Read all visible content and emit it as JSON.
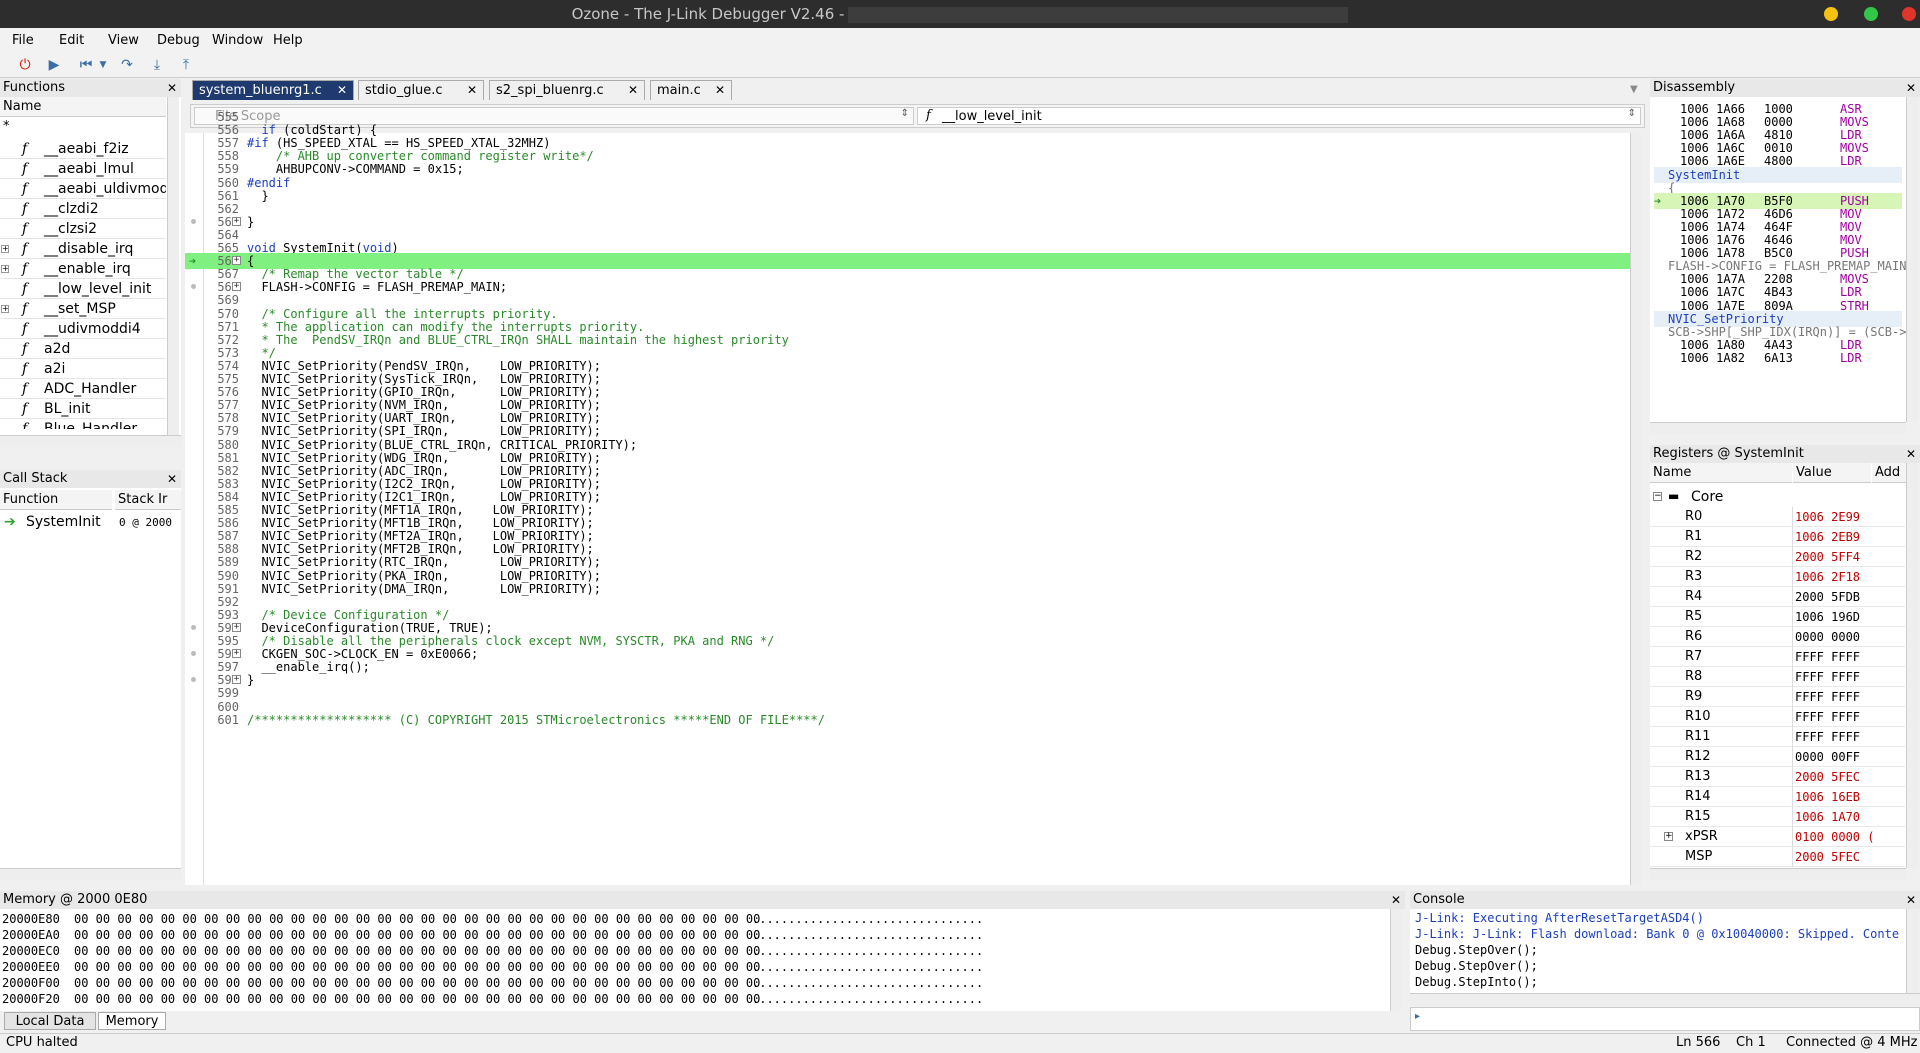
{
  "window": {
    "title": "Ozone - The J-Link Debugger V2.46 -"
  },
  "menu": [
    "File",
    "Edit",
    "View",
    "Debug",
    "Window",
    "Help"
  ],
  "functions": {
    "title": "Functions",
    "column": "Name",
    "filter": "*",
    "items": [
      "__aeabi_f2iz",
      "__aeabi_lmul",
      "__aeabi_uldivmod",
      "__clzdi2",
      "__clzsi2",
      "__disable_irq",
      "__enable_irq",
      "__low_level_init",
      "__set_MSP",
      "__udivmoddi4",
      "a2d",
      "a2i",
      "ADC_Handler",
      "BL_init",
      "Blue_Handler"
    ]
  },
  "callstack": {
    "title": "Call Stack",
    "col_function": "Function",
    "col_stack": "Stack Ir",
    "row_function": "SystemInit",
    "row_stack": "0 @ 2000"
  },
  "tabs": [
    "system_bluenrg1.c",
    "stdio_glue.c",
    "s2_spi_bluenrg.c",
    "main.c"
  ],
  "editor": {
    "scope_placeholder": "File Scope",
    "function_scope": "__low_level_init",
    "function_glyph": "f",
    "lines": [
      {
        "n": "555",
        "t": ""
      },
      {
        "n": "556",
        "t": "  if (coldStart) {"
      },
      {
        "n": "557",
        "t": "#if (HS_SPEED_XTAL == HS_SPEED_XTAL_32MHZ)"
      },
      {
        "n": "558",
        "t": "    /* AHB up converter command register write*/"
      },
      {
        "n": "559",
        "t": "    AHBUPCONV->COMMAND = 0x15;"
      },
      {
        "n": "560",
        "t": "#endif"
      },
      {
        "n": "561",
        "t": "  }"
      },
      {
        "n": "562",
        "t": ""
      },
      {
        "n": "563",
        "t": "}"
      },
      {
        "n": "564",
        "t": ""
      },
      {
        "n": "565",
        "t": "void SystemInit(void)"
      },
      {
        "n": "566",
        "t": "{"
      },
      {
        "n": "567",
        "t": "  /* Remap the vector table */"
      },
      {
        "n": "568",
        "t": "  FLASH->CONFIG = FLASH_PREMAP_MAIN;"
      },
      {
        "n": "569",
        "t": ""
      },
      {
        "n": "570",
        "t": "  /* Configure all the interrupts priority."
      },
      {
        "n": "571",
        "t": "  * The application can modify the interrupts priority."
      },
      {
        "n": "572",
        "t": "  * The  PendSV_IRQn and BLUE_CTRL_IRQn SHALL maintain the highest priority"
      },
      {
        "n": "573",
        "t": "  */"
      },
      {
        "n": "574",
        "t": "  NVIC_SetPriority(PendSV_IRQn,    LOW_PRIORITY);"
      },
      {
        "n": "575",
        "t": "  NVIC_SetPriority(SysTick_IRQn,   LOW_PRIORITY);"
      },
      {
        "n": "576",
        "t": "  NVIC_SetPriority(GPIO_IRQn,      LOW_PRIORITY);"
      },
      {
        "n": "577",
        "t": "  NVIC_SetPriority(NVM_IRQn,       LOW_PRIORITY);"
      },
      {
        "n": "578",
        "t": "  NVIC_SetPriority(UART_IRQn,      LOW_PRIORITY);"
      },
      {
        "n": "579",
        "t": "  NVIC_SetPriority(SPI_IRQn,       LOW_PRIORITY);"
      },
      {
        "n": "580",
        "t": "  NVIC_SetPriority(BLUE_CTRL_IRQn, CRITICAL_PRIORITY);"
      },
      {
        "n": "581",
        "t": "  NVIC_SetPriority(WDG_IRQn,       LOW_PRIORITY);"
      },
      {
        "n": "582",
        "t": "  NVIC_SetPriority(ADC_IRQn,       LOW_PRIORITY);"
      },
      {
        "n": "583",
        "t": "  NVIC_SetPriority(I2C2_IRQn,      LOW_PRIORITY);"
      },
      {
        "n": "584",
        "t": "  NVIC_SetPriority(I2C1_IRQn,      LOW_PRIORITY);"
      },
      {
        "n": "585",
        "t": "  NVIC_SetPriority(MFT1A_IRQn,    LOW_PRIORITY);"
      },
      {
        "n": "586",
        "t": "  NVIC_SetPriority(MFT1B_IRQn,    LOW_PRIORITY);"
      },
      {
        "n": "587",
        "t": "  NVIC_SetPriority(MFT2A_IRQn,    LOW_PRIORITY);"
      },
      {
        "n": "588",
        "t": "  NVIC_SetPriority(MFT2B_IRQn,    LOW_PRIORITY);"
      },
      {
        "n": "589",
        "t": "  NVIC_SetPriority(RTC_IRQn,       LOW_PRIORITY);"
      },
      {
        "n": "590",
        "t": "  NVIC_SetPriority(PKA_IRQn,       LOW_PRIORITY);"
      },
      {
        "n": "591",
        "t": "  NVIC_SetPriority(DMA_IRQn,       LOW_PRIORITY);"
      },
      {
        "n": "592",
        "t": ""
      },
      {
        "n": "593",
        "t": "  /* Device Configuration */"
      },
      {
        "n": "594",
        "t": "  DeviceConfiguration(TRUE, TRUE);"
      },
      {
        "n": "595",
        "t": "  /* Disable all the peripherals clock except NVM, SYSCTR, PKA and RNG */"
      },
      {
        "n": "596",
        "t": "  CKGEN_SOC->CLOCK_EN = 0xE0066;"
      },
      {
        "n": "597",
        "t": "  __enable_irq();"
      },
      {
        "n": "598",
        "t": "}"
      },
      {
        "n": "599",
        "t": ""
      },
      {
        "n": "600",
        "t": ""
      },
      {
        "n": "601",
        "t": "/******************* (C) COPYRIGHT 2015 STMicroelectronics *****END OF FILE****/"
      }
    ]
  },
  "disassembly": {
    "title": "Disassembly",
    "rows": [
      {
        "addr": "1006 1A66",
        "op": "1000",
        "mn": "ASR"
      },
      {
        "addr": "1006 1A68",
        "op": "0000",
        "mn": "MOVS"
      },
      {
        "addr": "1006 1A6A",
        "op": "4810",
        "mn": "LDR"
      },
      {
        "addr": "1006 1A6C",
        "op": "0010",
        "mn": "MOVS"
      },
      {
        "addr": "1006 1A6E",
        "op": "4800",
        "mn": "LDR"
      },
      {
        "label": "SystemInit"
      },
      {
        "src": "{"
      },
      {
        "addr": "1006 1A70",
        "op": "B5F0",
        "mn": "PUSH"
      },
      {
        "addr": "1006 1A72",
        "op": "46D6",
        "mn": "MOV"
      },
      {
        "addr": "1006 1A74",
        "op": "464F",
        "mn": "MOV"
      },
      {
        "addr": "1006 1A76",
        "op": "4646",
        "mn": "MOV"
      },
      {
        "addr": "1006 1A78",
        "op": "B5C0",
        "mn": "PUSH"
      },
      {
        "src": "FLASH->CONFIG = FLASH_PREMAP_MAIN;"
      },
      {
        "addr": "1006 1A7A",
        "op": "2208",
        "mn": "MOVS"
      },
      {
        "addr": "1006 1A7C",
        "op": "4B43",
        "mn": "LDR"
      },
      {
        "addr": "1006 1A7E",
        "op": "809A",
        "mn": "STRH"
      },
      {
        "label": "NVIC_SetPriority"
      },
      {
        "src": "SCB->SHP[_SHP_IDX(IRQn)] = (SCB->S"
      },
      {
        "addr": "1006 1A80",
        "op": "4A43",
        "mn": "LDR"
      },
      {
        "addr": "1006 1A82",
        "op": "6A13",
        "mn": "LDR"
      }
    ]
  },
  "registers": {
    "title": "Registers @ SystemInit",
    "col_name": "Name",
    "col_value": "Value",
    "col_addr": "Add",
    "group": "Core",
    "rows": [
      {
        "name": "R0",
        "value": "1006 2E99",
        "changed": true
      },
      {
        "name": "R1",
        "value": "1006 2EB9",
        "changed": true
      },
      {
        "name": "R2",
        "value": "2000 5FF4",
        "changed": true
      },
      {
        "name": "R3",
        "value": "1006 2F18",
        "changed": true
      },
      {
        "name": "R4",
        "value": "2000 5FDB",
        "changed": false
      },
      {
        "name": "R5",
        "value": "1006 196D",
        "changed": false
      },
      {
        "name": "R6",
        "value": "0000 0000",
        "changed": false
      },
      {
        "name": "R7",
        "value": "FFFF FFFF",
        "changed": false
      },
      {
        "name": "R8",
        "value": "FFFF FFFF",
        "changed": false
      },
      {
        "name": "R9",
        "value": "FFFF FFFF",
        "changed": false
      },
      {
        "name": "R10",
        "value": "FFFF FFFF",
        "changed": false
      },
      {
        "name": "R11",
        "value": "FFFF FFFF",
        "changed": false
      },
      {
        "name": "R12",
        "value": "0000 00FF",
        "changed": false
      },
      {
        "name": "R13",
        "value": "2000 5FEC",
        "changed": true
      },
      {
        "name": "R14",
        "value": "1006 16EB",
        "changed": true
      },
      {
        "name": "R15",
        "value": "1006 1A70",
        "changed": true
      },
      {
        "name": "xPSR",
        "value": "0100 0000 (",
        "changed": true
      },
      {
        "name": "MSP",
        "value": "2000 5FEC",
        "changed": true
      }
    ]
  },
  "memory": {
    "title": "Memory @ 2000 0E80",
    "rows": [
      {
        "addr": "20000E80",
        "bytes": "00 00 00 00 00 00 00 00 00 00 00 00 00 00 00 00 00 00 00 00 00 00 00 00 00 00 00 00 00 00 00 00",
        "ascii": "................................"
      },
      {
        "addr": "20000EA0",
        "bytes": "00 00 00 00 00 00 00 00 00 00 00 00 00 00 00 00 00 00 00 00 00 00 00 00 00 00 00 00 00 00 00 00",
        "ascii": "................................"
      },
      {
        "addr": "20000EC0",
        "bytes": "00 00 00 00 00 00 00 00 00 00 00 00 00 00 00 00 00 00 00 00 00 00 00 00 00 00 00 00 00 00 00 00",
        "ascii": "................................"
      },
      {
        "addr": "20000EE0",
        "bytes": "00 00 00 00 00 00 00 00 00 00 00 00 00 00 00 00 00 00 00 00 00 00 00 00 00 00 00 00 00 00 00 00",
        "ascii": "................................"
      },
      {
        "addr": "20000F00",
        "bytes": "00 00 00 00 00 00 00 00 00 00 00 00 00 00 00 00 00 00 00 00 00 00 00 00 00 00 00 00 00 00 00 00",
        "ascii": "................................"
      },
      {
        "addr": "20000F20",
        "bytes": "00 00 00 00 00 00 00 00 00 00 00 00 00 00 00 00 00 00 00 00 00 00 00 00 00 00 00 00 00 00 00 00",
        "ascii": "................................"
      }
    ],
    "tabs": [
      "Local Data",
      "Memory"
    ]
  },
  "console": {
    "title": "Console",
    "lines": [
      {
        "t": "J-Link: Executing AfterResetTargetASD4()",
        "blue": true
      },
      {
        "t": "J-Link: J-Link: Flash download: Bank 0 @ 0x10040000: Skipped. Conte",
        "blue": true
      },
      {
        "t": "Debug.StepOver();",
        "blue": false
      },
      {
        "t": "Debug.StepOver();",
        "blue": false
      },
      {
        "t": "Debug.StepInto();",
        "blue": false
      }
    ]
  },
  "status": {
    "left": "CPU halted",
    "ln": "Ln 566",
    "ch": "Ch 1",
    "conn": "Connected @ 4 MHz"
  },
  "colors": {
    "pc_line": "#80f080",
    "comment": "#2a8a2a",
    "keyword": "#1c3fbf",
    "changed": "#c00000",
    "mnemonic": "#a000a0",
    "tab_active": "#1e3a6e"
  },
  "icons": {
    "power": "power-icon",
    "run": "continue-icon",
    "reset": "reset-icon",
    "step_over": "step-over-icon",
    "step_into": "step-into-icon",
    "step_out": "step-out-icon"
  }
}
